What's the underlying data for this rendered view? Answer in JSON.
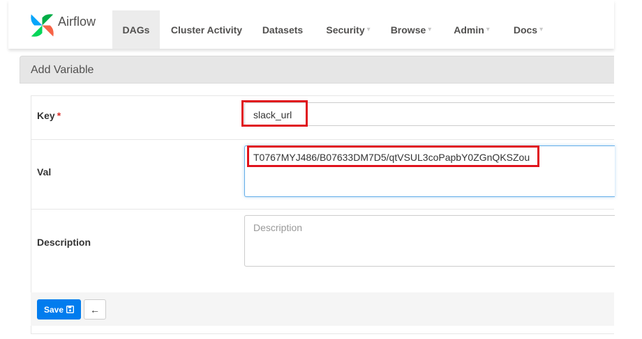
{
  "navbar": {
    "brand": "Airflow",
    "items": [
      {
        "label": "DAGs",
        "dropdown": false,
        "active": true
      },
      {
        "label": "Cluster Activity",
        "dropdown": false
      },
      {
        "label": "Datasets",
        "dropdown": false
      },
      {
        "label": "Security",
        "dropdown": true
      },
      {
        "label": "Browse",
        "dropdown": true
      },
      {
        "label": "Admin",
        "dropdown": true
      },
      {
        "label": "Docs",
        "dropdown": true
      }
    ]
  },
  "form": {
    "title": "Add Variable",
    "key_label": "Key",
    "required_marker": "*",
    "key_value": "slack_url",
    "val_label": "Val",
    "val_value": "T0767MYJ486/B07633DM7D5/qtVSUL3coPapbY0ZGnQKSZou",
    "description_label": "Description",
    "description_placeholder": "Description",
    "save_label": "Save",
    "back_icon": "arrow-left-icon",
    "save_icon": "save-icon"
  },
  "colors": {
    "accent": "#017cee",
    "highlight": "#e0121c",
    "required": "#d9302c"
  }
}
